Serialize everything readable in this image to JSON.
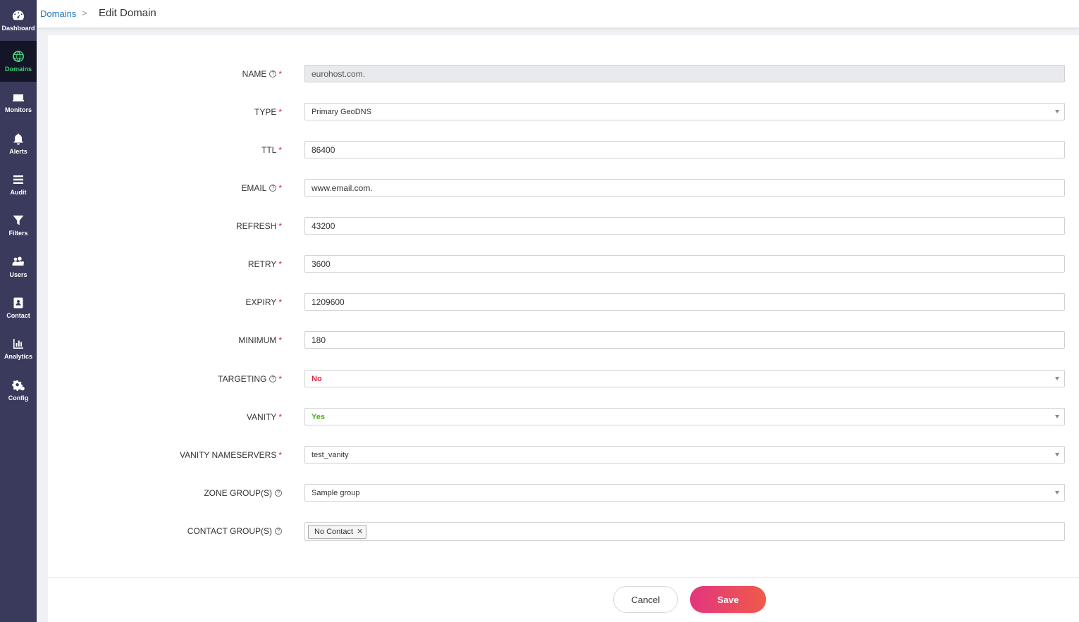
{
  "sidebar": {
    "items": [
      {
        "label": "Dashboard",
        "icon": "dashboard-icon",
        "active": false
      },
      {
        "label": "Domains",
        "icon": "globe-icon",
        "active": true
      },
      {
        "label": "Monitors",
        "icon": "monitor-icon",
        "active": false
      },
      {
        "label": "Alerts",
        "icon": "bell-icon",
        "active": false
      },
      {
        "label": "Audit",
        "icon": "list-icon",
        "active": false
      },
      {
        "label": "Filters",
        "icon": "filter-icon",
        "active": false
      },
      {
        "label": "Users",
        "icon": "users-icon",
        "active": false
      },
      {
        "label": "Contact",
        "icon": "contact-icon",
        "active": false
      },
      {
        "label": "Analytics",
        "icon": "chart-icon",
        "active": false
      },
      {
        "label": "Config",
        "icon": "gears-icon",
        "active": false
      }
    ],
    "active_color": "#3fd07a",
    "background": "#3a3a5c"
  },
  "breadcrumb": {
    "parent": "Domains",
    "separator": ">",
    "current": "Edit Domain"
  },
  "form": {
    "name": {
      "label": "NAME",
      "value": "eurohost.com."
    },
    "type": {
      "label": "TYPE",
      "value": "Primary GeoDNS"
    },
    "ttl": {
      "label": "TTL",
      "value": "86400"
    },
    "email": {
      "label": "EMAIL",
      "value": "www.email.com."
    },
    "refresh": {
      "label": "REFRESH",
      "value": "43200"
    },
    "retry": {
      "label": "RETRY",
      "value": "3600"
    },
    "expiry": {
      "label": "EXPIRY",
      "value": "1209600"
    },
    "minimum": {
      "label": "MINIMUM",
      "value": "180"
    },
    "targeting": {
      "label": "TARGETING",
      "value": "No"
    },
    "vanity": {
      "label": "VANITY",
      "value": "Yes"
    },
    "vanity_nameservers": {
      "label": "VANITY NAMESERVERS",
      "value": "test_vanity"
    },
    "zone_groups": {
      "label": "ZONE GROUP(S)",
      "value": "Sample group"
    },
    "contact_groups": {
      "label": "CONTACT GROUP(S)",
      "tags": [
        "No Contact"
      ]
    }
  },
  "actions": {
    "cancel_label": "Cancel",
    "save_label": "Save"
  },
  "colors": {
    "required": "#d9233a",
    "yes": "#4caf1e",
    "no": "#d9233a",
    "save_gradient_start": "#e2357f",
    "save_gradient_end": "#f05a4a"
  }
}
